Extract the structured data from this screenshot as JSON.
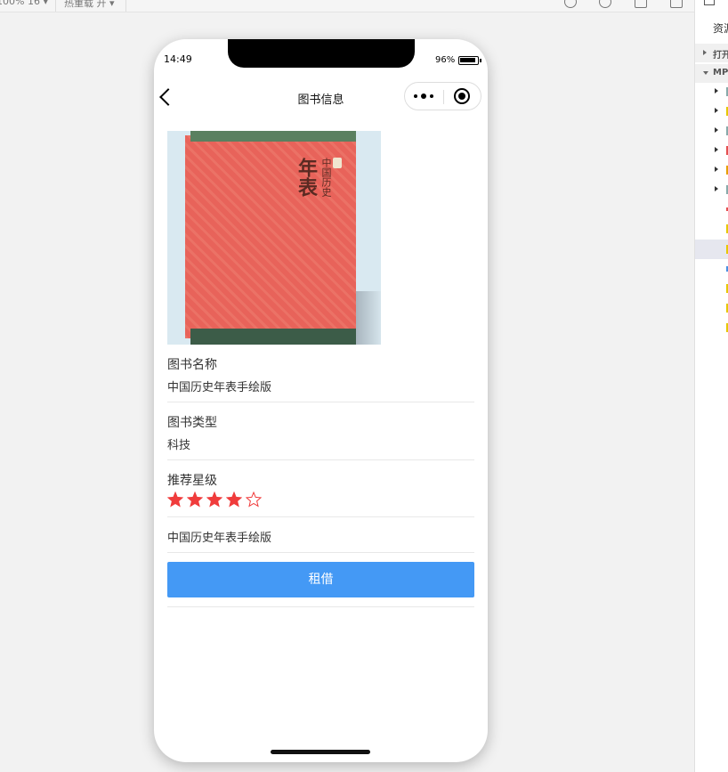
{
  "ide_toolbar": {
    "zoom_label": "100% 16 ▾",
    "reload_label": "热重载 开 ▾"
  },
  "right_panel": {
    "resources_label": "资源",
    "open_label": "打开",
    "mp_label": "MP"
  },
  "status_bar": {
    "time": "14:49",
    "battery_pct": "96%"
  },
  "nav": {
    "title": "图书信息"
  },
  "cover": {
    "title_big": "年表",
    "title_small": "中国历史"
  },
  "book": {
    "name_label": "图书名称",
    "name_value": "中国历史年表手绘版",
    "type_label": "图书类型",
    "type_value": "科技",
    "rating_label": "推荐星级",
    "rating": 4,
    "rating_max": 5,
    "description": "中国历史年表手绘版"
  },
  "actions": {
    "rent_label": "租借"
  },
  "colors": {
    "star": "#f03c3c",
    "button": "#4499f5"
  }
}
